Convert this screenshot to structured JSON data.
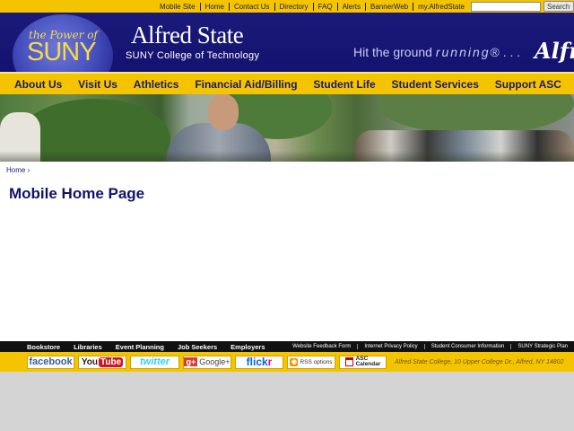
{
  "topbar": {
    "links": [
      "Mobile Site",
      "Home",
      "Contact Us",
      "Directory",
      "FAQ",
      "Alerts",
      "BannerWeb",
      "my.AlfredState"
    ],
    "search_button": "Search",
    "search_value": ""
  },
  "header": {
    "suny_small": "the Power of",
    "suny_big": "SUNY",
    "brand_name": "Alfred State",
    "brand_sub": "SUNY College of Technology",
    "tagline_lead": "Hit the ground ",
    "tagline_em": "running",
    "tagline_tail": "® . . .",
    "script_text": "Alfred"
  },
  "nav": {
    "items": [
      "About Us",
      "Visit Us",
      "Athletics",
      "Financial Aid/Billing",
      "Student Life",
      "Student Services",
      "Support ASC"
    ]
  },
  "breadcrumb": "Home ›",
  "page_title": "Mobile Home Page",
  "footer": {
    "left_links": [
      "Bookstore",
      "Libraries",
      "Event Planning",
      "Job Seekers",
      "Employers"
    ],
    "right_links": [
      "Website Feedback Form",
      "Internet Privacy Policy",
      "Student Consumer Information",
      "SUNY Strategic Plan"
    ],
    "social": {
      "facebook": "facebook",
      "youtube_a": "You",
      "youtube_b": "Tube",
      "twitter": "twitter",
      "google_badge": "g+",
      "google": "Google+",
      "flickr_a": "flick",
      "flickr_b": "r",
      "rss": "RSS options",
      "cal_a": "ASC",
      "cal_b": "Calendar"
    },
    "address": "Alfred State College, 10 Upper College Dr., Alfred, NY 14802"
  },
  "colors": {
    "gold": "#f5c400",
    "navy": "#1b1a7a",
    "title": "#12126a"
  }
}
